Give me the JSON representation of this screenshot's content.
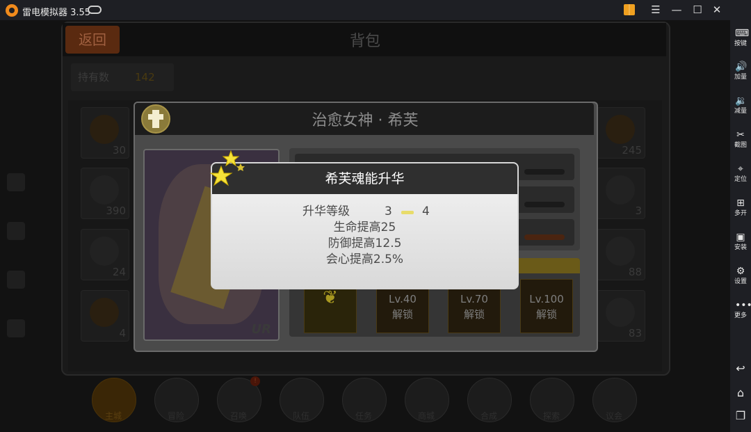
{
  "window": {
    "title": "雷电模拟器 3.55"
  },
  "sidebar": {
    "items": [
      {
        "label": "按键",
        "icon": "keyboard-icon"
      },
      {
        "label": "加量",
        "icon": "volume-up-icon"
      },
      {
        "label": "减量",
        "icon": "volume-down-icon"
      },
      {
        "label": "截图",
        "icon": "scissors-icon"
      },
      {
        "label": "定位",
        "icon": "location-icon"
      },
      {
        "label": "多开",
        "icon": "multi-instance-icon"
      },
      {
        "label": "安装",
        "icon": "apk-icon"
      },
      {
        "label": "设置",
        "icon": "gear-icon"
      },
      {
        "label": "更多",
        "icon": "more-icon"
      }
    ]
  },
  "bag": {
    "title": "背包",
    "back_label": "返回",
    "hold_label": "持有数",
    "hold_count": "142",
    "slot_counts": {
      "c1r1": "30",
      "c1r2": "390",
      "c1r3": "24",
      "c1r4": "4",
      "c9r1": "245",
      "c9r2": "3",
      "c9r3": "88",
      "c9r4": "83"
    }
  },
  "hero": {
    "name": "治愈女神 · 希芙",
    "rarity": "UR"
  },
  "skills": [
    {
      "label": ""
    },
    {
      "label": "Lv.40\n解锁",
      "line1": "Lv.40",
      "line2": "解锁"
    },
    {
      "label": "Lv.70\n解锁",
      "line1": "Lv.70",
      "line2": "解锁"
    },
    {
      "label": "Lv.100\n解锁",
      "line1": "Lv.100",
      "line2": "解锁"
    }
  ],
  "popup": {
    "title": "希芙魂能升华",
    "level_label": "升华等级",
    "level_from": "3",
    "level_to": "4",
    "bonus_hp": "生命提高25",
    "bonus_def": "防御提高12.5",
    "bonus_crit": "会心提高2.5%"
  },
  "nav": [
    {
      "label": "主城"
    },
    {
      "label": "冒险"
    },
    {
      "label": "召唤",
      "badge": "!"
    },
    {
      "label": "队伍"
    },
    {
      "label": "任务"
    },
    {
      "label": "商城"
    },
    {
      "label": "合成"
    },
    {
      "label": "探索"
    },
    {
      "label": "议会"
    }
  ],
  "colors": {
    "accent_gold": "#d4b02a",
    "popup_header": "#2f2f2f"
  }
}
